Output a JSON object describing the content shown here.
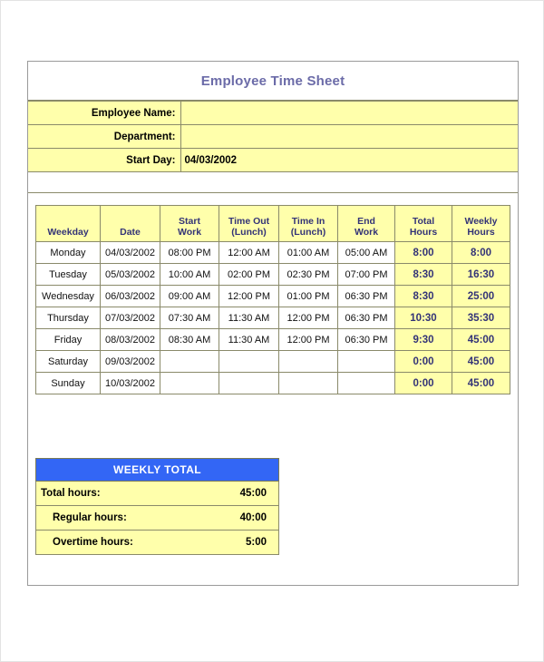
{
  "document": {
    "title": "Employee Time Sheet"
  },
  "form": {
    "rows": [
      {
        "label": "Employee Name:",
        "value": ""
      },
      {
        "label": "Department:",
        "value": ""
      },
      {
        "label": "Start Day:",
        "value": "04/03/2002"
      }
    ]
  },
  "timesheet": {
    "columns": [
      {
        "line1": "",
        "line2": "Weekday"
      },
      {
        "line1": "",
        "line2": "Date"
      },
      {
        "line1": "Start",
        "line2": "Work"
      },
      {
        "line1": "Time Out",
        "line2": "(Lunch)"
      },
      {
        "line1": "Time In",
        "line2": "(Lunch)"
      },
      {
        "line1": "End",
        "line2": "Work"
      },
      {
        "line1": "Total",
        "line2": "Hours"
      },
      {
        "line1": "Weekly",
        "line2": "Hours"
      }
    ],
    "rows": [
      {
        "weekday": "Monday",
        "date": "04/03/2002",
        "start_work": "08:00 PM",
        "time_out_lunch": "12:00 AM",
        "time_in_lunch": "01:00 AM",
        "end_work": "05:00 AM",
        "total_hours": "8:00",
        "weekly_hours": "8:00"
      },
      {
        "weekday": "Tuesday",
        "date": "05/03/2002",
        "start_work": "10:00 AM",
        "time_out_lunch": "02:00 PM",
        "time_in_lunch": "02:30 PM",
        "end_work": "07:00 PM",
        "total_hours": "8:30",
        "weekly_hours": "16:30"
      },
      {
        "weekday": "Wednesday",
        "date": "06/03/2002",
        "start_work": "09:00 AM",
        "time_out_lunch": "12:00 PM",
        "time_in_lunch": "01:00 PM",
        "end_work": "06:30 PM",
        "total_hours": "8:30",
        "weekly_hours": "25:00"
      },
      {
        "weekday": "Thursday",
        "date": "07/03/2002",
        "start_work": "07:30 AM",
        "time_out_lunch": "11:30 AM",
        "time_in_lunch": "12:00 PM",
        "end_work": "06:30 PM",
        "total_hours": "10:30",
        "weekly_hours": "35:30"
      },
      {
        "weekday": "Friday",
        "date": "08/03/2002",
        "start_work": "08:30 AM",
        "time_out_lunch": "11:30 AM",
        "time_in_lunch": "12:00 PM",
        "end_work": "06:30 PM",
        "total_hours": "9:30",
        "weekly_hours": "45:00"
      },
      {
        "weekday": "Saturday",
        "date": "09/03/2002",
        "start_work": "",
        "time_out_lunch": "",
        "time_in_lunch": "",
        "end_work": "",
        "total_hours": "0:00",
        "weekly_hours": "45:00"
      },
      {
        "weekday": "Sunday",
        "date": "10/03/2002",
        "start_work": "",
        "time_out_lunch": "",
        "time_in_lunch": "",
        "end_work": "",
        "total_hours": "0:00",
        "weekly_hours": "45:00"
      }
    ]
  },
  "weekly_total": {
    "heading": "WEEKLY TOTAL",
    "rows": [
      {
        "label": "Total hours:",
        "value": "45:00",
        "indent": false
      },
      {
        "label": "Regular hours:",
        "value": "40:00",
        "indent": true
      },
      {
        "label": "Overtime hours:",
        "value": "5:00",
        "indent": true
      }
    ]
  },
  "colors": {
    "title_text": "#6b6ba8",
    "cell_yellow": "#ffffab",
    "header_blue_text": "#333377",
    "weekly_total_bar": "#3366f5",
    "grid_line": "#8a8a6a"
  }
}
